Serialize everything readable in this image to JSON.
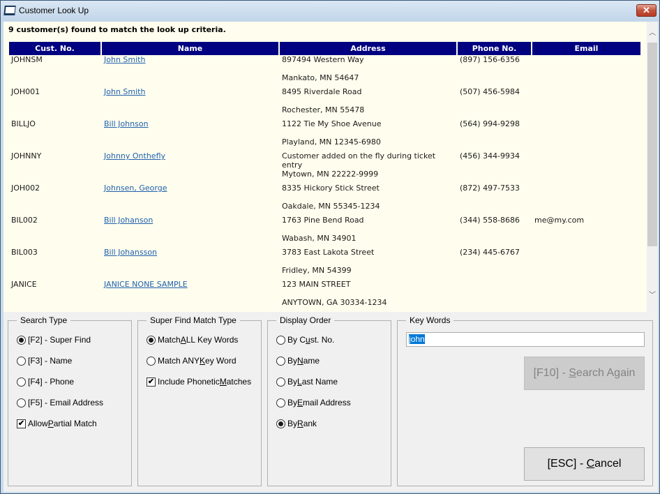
{
  "window": {
    "title": "Customer Look Up",
    "close_glyph": "✕"
  },
  "results": {
    "message": "9 customer(s) found to match the look up criteria.",
    "columns": [
      "Cust. No.",
      "Name",
      "Address",
      "Phone No.",
      "Email"
    ],
    "rows": [
      {
        "cust_no": "JOHNSM",
        "name": "John Smith",
        "address1": "897494 Western Way",
        "address2": "Mankato, MN 54647",
        "phone": "(897) 156-6356",
        "email": ""
      },
      {
        "cust_no": "JOH001",
        "name": "John Smith",
        "address1": "8495 Riverdale Road",
        "address2": "Rochester, MN 55478",
        "phone": "(507) 456-5984",
        "email": ""
      },
      {
        "cust_no": "BILLJO",
        "name": "Bill Johnson",
        "address1": "1122 Tie My Shoe Avenue",
        "address2": "Playland, MN 12345-6980",
        "phone": "(564) 994-9298",
        "email": ""
      },
      {
        "cust_no": "JOHNNY",
        "name": "Johnny Onthefly",
        "address1": "Customer added on the fly during ticket entry",
        "address2": "Mytown, MN 22222-9999",
        "phone": "(456) 344-9934",
        "email": ""
      },
      {
        "cust_no": "JOH002",
        "name": "Johnsen, George",
        "address1": "8335 Hickory Stick Street",
        "address2": "Oakdale, MN 55345-1234",
        "phone": "(872) 497-7533",
        "email": ""
      },
      {
        "cust_no": "BIL002",
        "name": "Bill Johanson",
        "address1": "1763 Pine Bend Road",
        "address2": "Wabash, MN 34901",
        "phone": "(344) 558-8686",
        "email": "me@my.com"
      },
      {
        "cust_no": "BIL003",
        "name": "Bill Johansson",
        "address1": "3783 East Lakota Street",
        "address2": "Fridley, MN 54399",
        "phone": "(234) 445-6767",
        "email": ""
      },
      {
        "cust_no": "JANICE",
        "name": "JANICE NONE SAMPLE",
        "address1": "123 MAIN STREET",
        "address2": "ANYTOWN, GA 30334-1234",
        "phone": "",
        "email": ""
      }
    ],
    "scroll_up_glyph": "︿",
    "scroll_down_glyph": "﹀"
  },
  "search_type": {
    "legend": "Search Type",
    "options": [
      {
        "label": "[F2] - Super Find",
        "checked": true
      },
      {
        "label": "[F3] - Name",
        "checked": false
      },
      {
        "label": "[F4] - Phone",
        "checked": false
      },
      {
        "label": "[F5] - Email Address",
        "checked": false
      }
    ],
    "partial_match": {
      "pre": "Allow ",
      "accel": "P",
      "post": "artial Match",
      "checked": true
    }
  },
  "match_type": {
    "legend": "Super Find Match Type",
    "options": [
      {
        "pre": "Match ",
        "accel": "A",
        "post": "LL Key Words",
        "checked": true
      },
      {
        "pre": "Match ANY ",
        "accel": "K",
        "post": "ey Word",
        "checked": false
      }
    ],
    "phonetic": {
      "pre": "Include Phonetic ",
      "accel": "M",
      "post": "atches",
      "checked": true
    }
  },
  "display_order": {
    "legend": "Display Order",
    "options": [
      {
        "pre": "By C",
        "accel": "u",
        "post": "st. No.",
        "checked": false
      },
      {
        "pre": "By ",
        "accel": "N",
        "post": "ame",
        "checked": false
      },
      {
        "pre": "By ",
        "accel": "L",
        "post": "ast Name",
        "checked": false
      },
      {
        "pre": "By ",
        "accel": "E",
        "post": "mail Address",
        "checked": false
      },
      {
        "pre": "By ",
        "accel": "R",
        "post": "ank",
        "checked": true
      }
    ]
  },
  "key_words": {
    "legend": "Key Words",
    "value": "john",
    "search_button": {
      "pre": "[F10] - ",
      "accel": "S",
      "post": "earch Again",
      "enabled": false
    },
    "cancel_button": {
      "pre": "[ESC] - ",
      "accel": "C",
      "post": "ancel"
    }
  },
  "check_glyph": "✔"
}
